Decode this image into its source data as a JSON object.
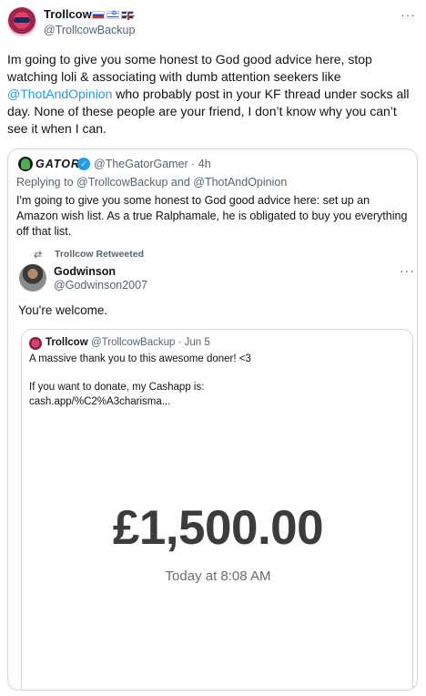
{
  "tweet": {
    "author_name": "Trollcow",
    "author_handle": "@TrollcowBackup",
    "flags": [
      "russia-flag",
      "israel-flag",
      "uk-flag"
    ],
    "text_before_mention": "Im going to give you some honest to God good advice here, stop watching loli & associating with dumb attention seekers like ",
    "mention": "@ThotAndOpinion",
    "text_after_mention": " who probably post in your KF thread under socks all day. None of these people are your friend, I don’t know why you can’t see it when I can.",
    "more_icon": "more-dots-icon"
  },
  "quoted": {
    "author_name": "GATOR",
    "verified_icon": "verified-badge-icon",
    "meta": "@TheGatorGamer · 4h",
    "replying_to": "Replying to @TrollcowBackup and @ThotAndOpinion",
    "text": "I'm going to give you some honest to God good advice here: set up an Amazon wish list. As a true Ralphamale, he is obligated to buy you everything off that list.",
    "retweet_label": "Trollcow Retweeted",
    "retweet_icon": "retweet-icon",
    "inner_author_name": "Godwinson",
    "inner_author_handle": "@Godwinson2007",
    "inner_text": "You're welcome."
  },
  "nested_quote": {
    "author_name": "Trollcow",
    "meta": "@TrollcowBackup · Jun 5",
    "text": "A massive thank you to this awesome doner! <3\n\nIf you want to donate, my Cashapp is:\ncash.app/%C2%A3charisma...",
    "amount": "£1,500.00",
    "date": "Today at 8:08 AM"
  },
  "colors": {
    "link": "#1d9bf0",
    "secondary_text": "#536471",
    "border": "#cfd9de"
  }
}
